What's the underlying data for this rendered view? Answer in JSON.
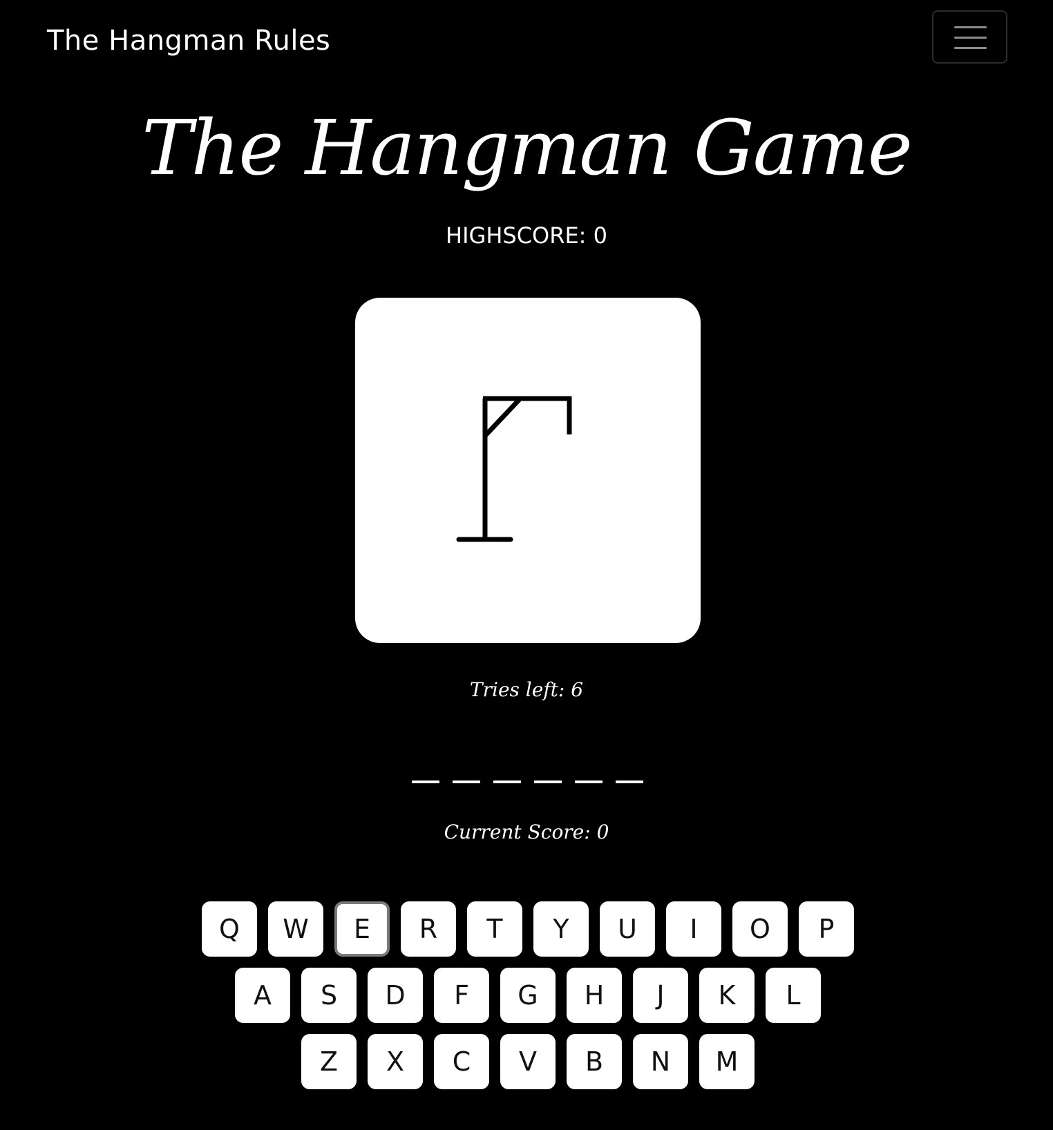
{
  "navbar": {
    "brand": "The Hangman Rules",
    "menu_icon": "hamburger-menu-icon"
  },
  "game": {
    "title": "The Hangman Game",
    "highscore_text": "HIGHSCORE: 0",
    "tries_text": "Tries left: 6",
    "score_text": "Current Score: 0",
    "word_slots": 6,
    "hangman_stage": "gallows-only"
  },
  "keyboard": {
    "rows": [
      [
        "Q",
        "W",
        "E",
        "R",
        "T",
        "Y",
        "U",
        "I",
        "O",
        "P"
      ],
      [
        "A",
        "S",
        "D",
        "F",
        "G",
        "H",
        "J",
        "K",
        "L"
      ],
      [
        "Z",
        "X",
        "C",
        "V",
        "B",
        "N",
        "M"
      ]
    ],
    "focused_key": "E"
  },
  "colors": {
    "background": "#000000",
    "foreground": "#ffffff",
    "key_text": "#111111",
    "focus_ring": "#7a7a7a"
  }
}
